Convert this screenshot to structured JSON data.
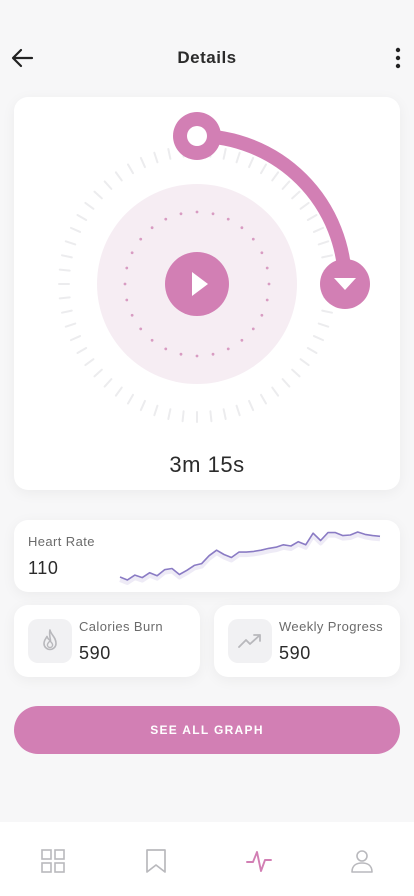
{
  "header": {
    "title": "Details",
    "back_icon": "arrow-left-icon",
    "menu_icon": "more-vertical-icon"
  },
  "timer": {
    "time_text": "3m 15s",
    "accent_color": "#d27fb4",
    "play_icon": "play-icon"
  },
  "heart_rate": {
    "label": "Heart Rate",
    "value": "110",
    "line_color": "#8a7bc4",
    "series": [
      52,
      47,
      55,
      51,
      59,
      54,
      64,
      66,
      56,
      63,
      71,
      74,
      87,
      96,
      89,
      84,
      93,
      93,
      94,
      96,
      99,
      101,
      105,
      103,
      110,
      105,
      124,
      112,
      125,
      125,
      120,
      121,
      126,
      122,
      120,
      119
    ]
  },
  "calories": {
    "label": "Calories Burn",
    "value": "590",
    "icon": "flame-icon"
  },
  "weekly": {
    "label": "Weekly Progress",
    "value": "590",
    "icon": "trending-up-icon"
  },
  "cta": {
    "label": "SEE ALL GRAPH"
  },
  "nav": {
    "items": [
      {
        "icon": "grid-icon",
        "active": false
      },
      {
        "icon": "bookmark-icon",
        "active": false
      },
      {
        "icon": "activity-icon",
        "active": true
      },
      {
        "icon": "user-icon",
        "active": false
      }
    ]
  }
}
